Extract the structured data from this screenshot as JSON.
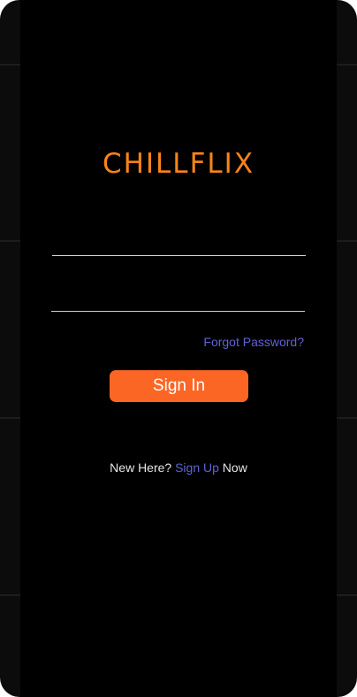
{
  "app": {
    "title": "CHILLFLIX"
  },
  "login": {
    "username_value": "",
    "password_value": "",
    "forgot_label": "Forgot Password?",
    "signin_label": "Sign In",
    "new_here_text": "New Here?",
    "signup_link_label": "Sign Up",
    "now_text": "Now"
  },
  "colors": {
    "brand": "#f7841b",
    "button": "#fb6625",
    "link": "#5f63d6",
    "background": "#000000"
  }
}
